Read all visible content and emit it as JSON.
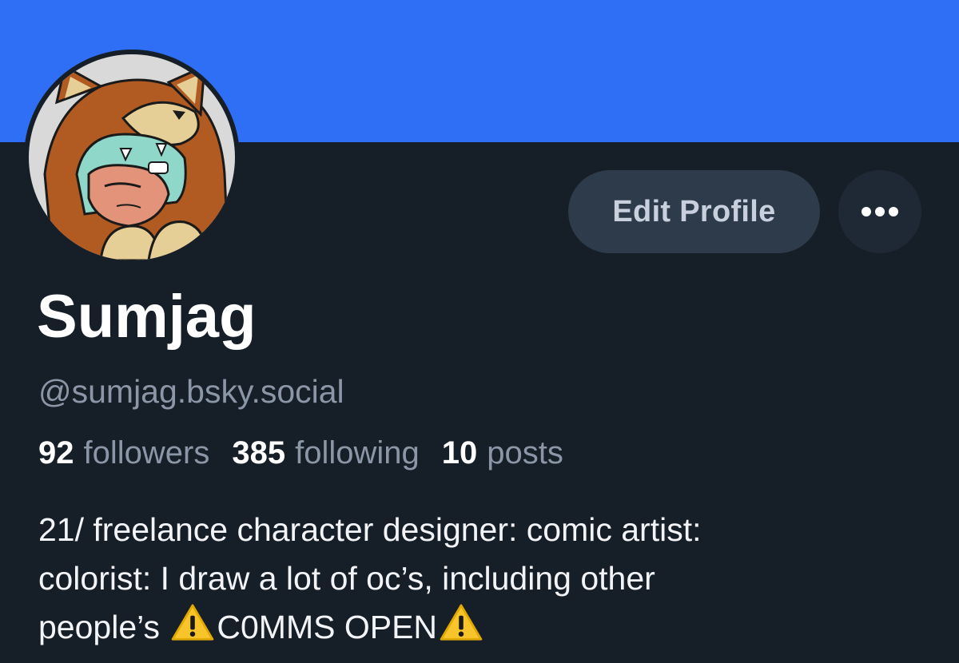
{
  "profile": {
    "display_name": "Sumjag",
    "handle": "@sumjag.bsky.social",
    "avatar_icon": "bear-hood-character-avatar",
    "banner_color": "#2f6ff5"
  },
  "actions": {
    "edit_profile_label": "Edit Profile",
    "more_icon": "ellipsis-icon"
  },
  "stats": {
    "followers_count": "92",
    "followers_label": "followers",
    "following_count": "385",
    "following_label": "following",
    "posts_count": "10",
    "posts_label": "posts"
  },
  "bio": {
    "line1": "21/ freelance character designer: comic artist:",
    "line2": "colorist: I draw a lot of oc’s, including other",
    "line3_prefix": "people’s ",
    "line3_emphasis": "C0MMS OPEN",
    "warning_icon": "warning-icon"
  }
}
